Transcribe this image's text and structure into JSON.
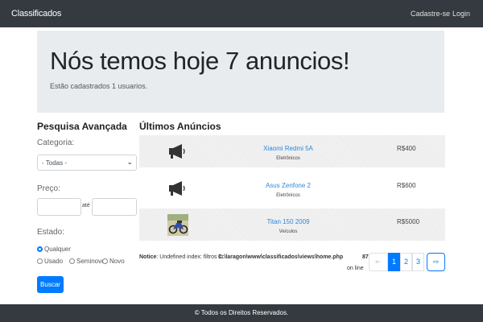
{
  "navbar": {
    "brand": "Classificados",
    "register": "Cadastre-se",
    "login": "Login"
  },
  "jumbotron": {
    "title": "Nós temos hoje 7 anuncios!",
    "subtitle": "Estão cadastrados 1 usuarios."
  },
  "filters": {
    "title": "Pesquisa Avançada",
    "category_label": "Categoria:",
    "category_value": "- Todas -",
    "price_label": "Preço:",
    "price_to": "até",
    "state_label": "Estado:",
    "states": [
      "Qualquer",
      "Usado",
      "Seminovo",
      "Novo"
    ],
    "selected_state": "Qualquer",
    "search_button": "Buscar"
  },
  "listing": {
    "title": "Últimos Anúncios",
    "ads": [
      {
        "title": "Xiaomi Redmi 5A",
        "category": "Eletrônicos",
        "price": "R$400",
        "thumb": "megaphone-icon"
      },
      {
        "title": "Asus Zenfone 2",
        "category": "Eletrônicos",
        "price": "R$600",
        "thumb": "megaphone-icon"
      },
      {
        "title": "Titan 150 2009",
        "category": "Veículos",
        "price": "R$5000",
        "thumb": "motorcycle-photo"
      }
    ]
  },
  "notice": {
    "label": "Notice",
    "message": ": Undefined index: filtros in",
    "file": "C:\\laragon\\www\\classificados\\views\\home.php",
    "file_suffix": "on line",
    "line": "87"
  },
  "pagination": {
    "prev_icon": "arrow-left-icon",
    "pages": [
      "1",
      "2",
      "3"
    ],
    "active_page": "1",
    "next_icon": "arrow-right-icon"
  },
  "footer": {
    "text": "© Todos os Direitos Reservados."
  },
  "colors": {
    "navbar": "#343a40",
    "jumbotron": "#e9ecef",
    "primary": "#007bff",
    "link": "#2b88d8"
  }
}
